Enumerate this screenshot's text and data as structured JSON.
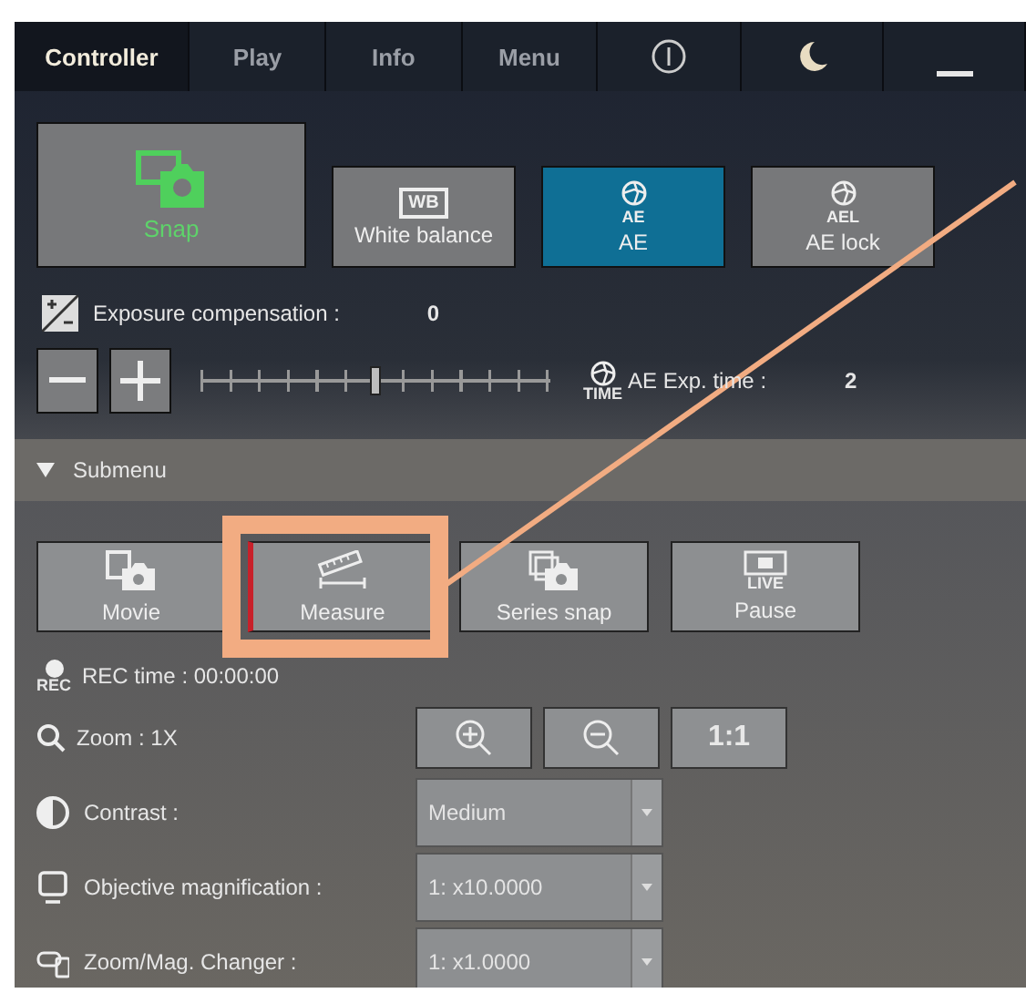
{
  "tabs": [
    {
      "label": "Controller",
      "selected": true
    },
    {
      "label": "Play",
      "selected": false
    },
    {
      "label": "Info",
      "selected": false
    },
    {
      "label": "Menu",
      "selected": false
    }
  ],
  "tab_icons": [
    {
      "kind": "power"
    },
    {
      "kind": "moon"
    },
    {
      "kind": "minimize"
    }
  ],
  "capture_buttons": [
    {
      "label": "Snap",
      "kind": "snap",
      "selected": false
    },
    {
      "label": "White balance",
      "kind": "wb",
      "badge": "WB",
      "selected": false
    },
    {
      "label": "AE",
      "kind": "ae",
      "badge": "AE",
      "selected": true
    },
    {
      "label": "AE lock",
      "kind": "ae",
      "badge": "AEL",
      "selected": false
    }
  ],
  "exposure": {
    "label": "Exposure compensation :",
    "value": "0",
    "level": 0.5
  },
  "ae_time": {
    "badge": "TIME",
    "label": "AE Exp. time :",
    "value": "2"
  },
  "submenu": {
    "label": "Submenu",
    "expanded": true,
    "buttons": [
      {
        "label": "Movie",
        "kind": "movie",
        "highlighted": false
      },
      {
        "label": "Measure",
        "kind": "measure",
        "highlighted": true
      },
      {
        "label": "Series snap",
        "kind": "series",
        "highlighted": false
      },
      {
        "label": "Pause",
        "kind": "live",
        "badge": "LIVE",
        "highlighted": false
      }
    ],
    "rec": {
      "badge": "REC",
      "label": "REC time : 00:00:00"
    },
    "zoom": {
      "label": "Zoom : 1X",
      "buttons": [
        {
          "kind": "zoom_in"
        },
        {
          "kind": "zoom_out"
        },
        {
          "kind": "text",
          "label": "1:1"
        }
      ]
    },
    "settings": [
      {
        "kind": "contrast",
        "label": "Contrast :",
        "value": "Medium"
      },
      {
        "kind": "objective",
        "label": "Objective magnification :",
        "value": "1: x10.0000"
      },
      {
        "kind": "changer",
        "label": "Zoom/Mag. Changer :",
        "value": "1: x1.0000"
      }
    ]
  }
}
